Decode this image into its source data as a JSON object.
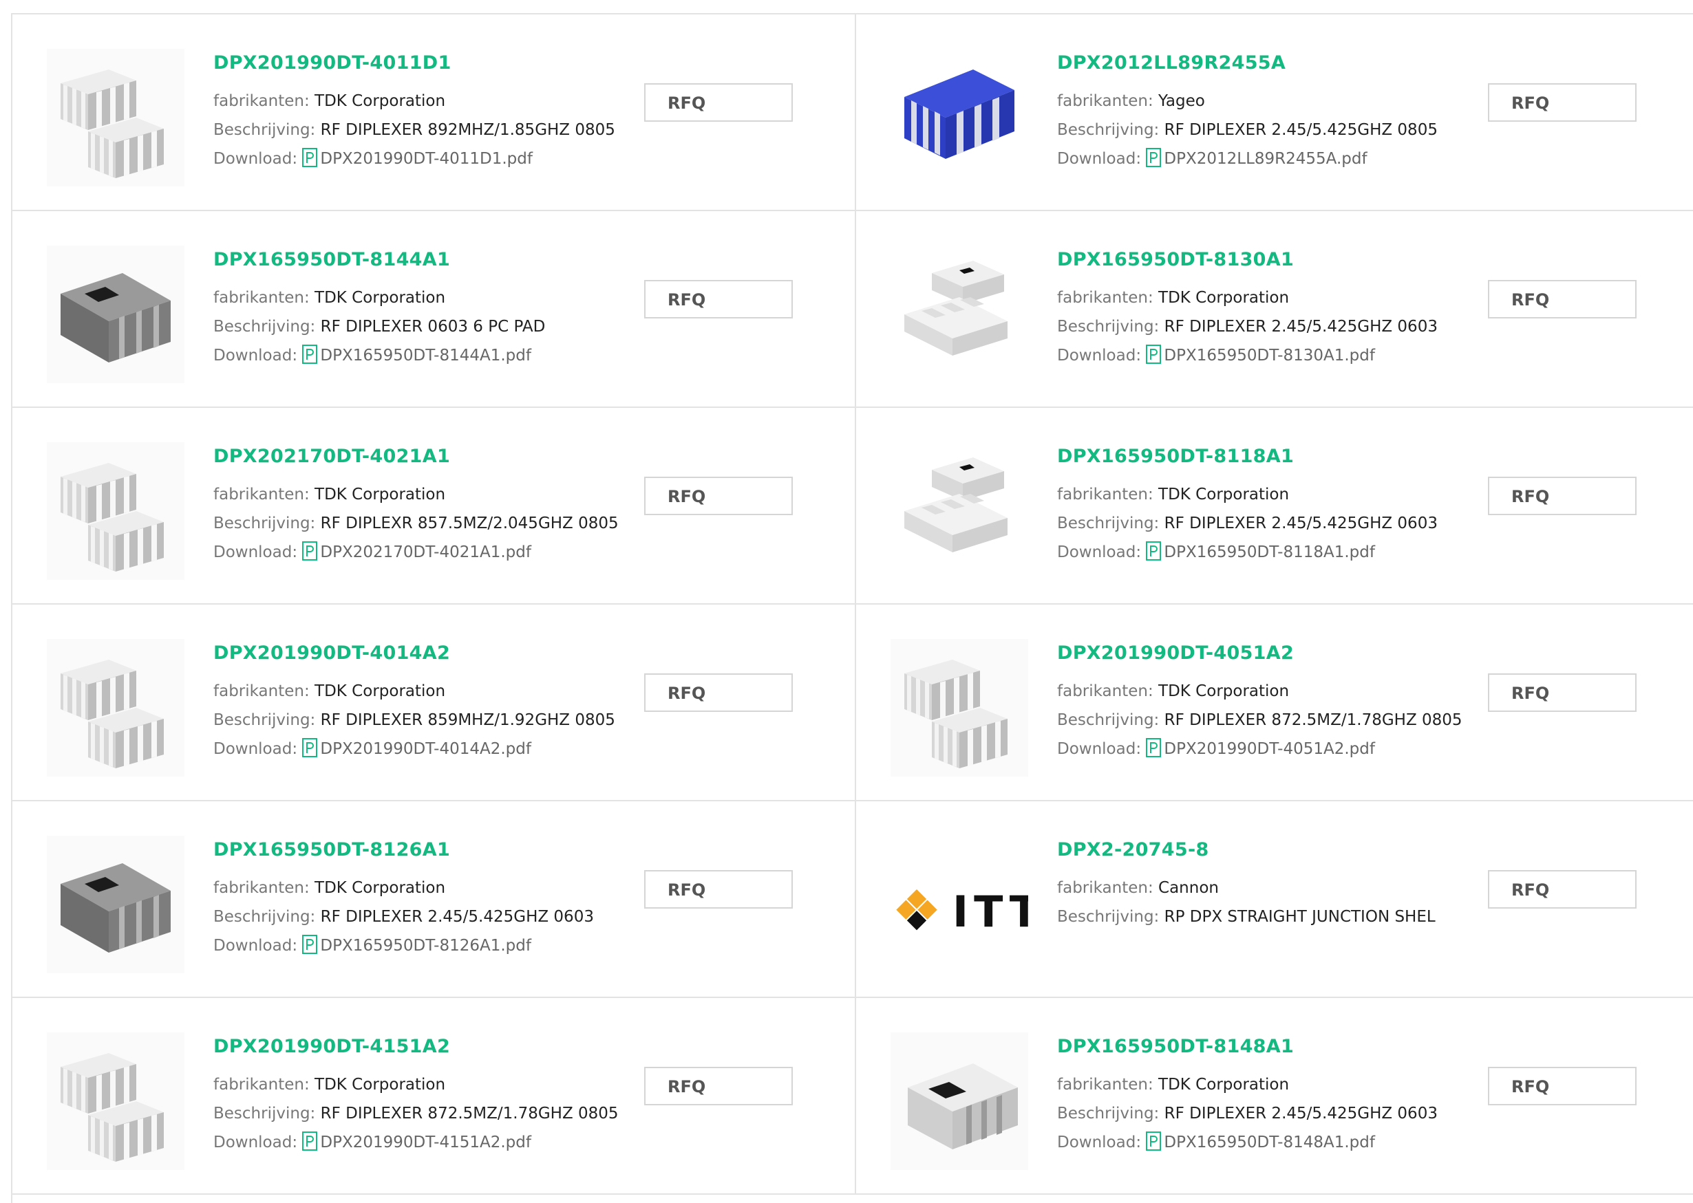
{
  "labels": {
    "manufacturer": "fabrikanten:",
    "description": "Beschrijving:",
    "download": "Download:",
    "rfq": "RFQ"
  },
  "colors": {
    "accent": "#12b980",
    "border": "#e3e3e3"
  },
  "products": [
    {
      "part": "DPX201990DT-4011D1",
      "manufacturer": "TDK Corporation",
      "description": "RF DIPLEXER 892MHZ/1.85GHZ 0805",
      "pdf": "DPX201990DT-4011D1.pdf",
      "image": "tdk-two-chips-icon"
    },
    {
      "part": "DPX2012LL89R2455A",
      "manufacturer": "Yageo",
      "description": "RF DIPLEXER 2.45/5.425GHZ 0805",
      "pdf": "DPX2012LL89R2455A.pdf",
      "image": "blue-chip-icon"
    },
    {
      "part": "DPX165950DT-8144A1",
      "manufacturer": "TDK Corporation",
      "description": "RF DIPLEXER 0603 6 PC PAD",
      "pdf": "DPX165950DT-8144A1.pdf",
      "image": "dark-chip-icon"
    },
    {
      "part": "DPX165950DT-8130A1",
      "manufacturer": "TDK Corporation",
      "description": "RF DIPLEXER 2.45/5.425GHZ 0603",
      "pdf": "DPX165950DT-8130A1.pdf",
      "image": "white-chips-icon"
    },
    {
      "part": "DPX202170DT-4021A1",
      "manufacturer": "TDK Corporation",
      "description": "RF DIPLEXR 857.5MZ/2.045GHZ 0805",
      "pdf": "DPX202170DT-4021A1.pdf",
      "image": "tdk-two-chips-icon"
    },
    {
      "part": "DPX165950DT-8118A1",
      "manufacturer": "TDK Corporation",
      "description": "RF DIPLEXER 2.45/5.425GHZ 0603",
      "pdf": "DPX165950DT-8118A1.pdf",
      "image": "white-chips-icon"
    },
    {
      "part": "DPX201990DT-4014A2",
      "manufacturer": "TDK Corporation",
      "description": "RF DIPLEXER 859MHZ/1.92GHZ 0805",
      "pdf": "DPX201990DT-4014A2.pdf",
      "image": "tdk-two-chips-icon"
    },
    {
      "part": "DPX201990DT-4051A2",
      "manufacturer": "TDK Corporation",
      "description": "RF DIPLEXER 872.5MZ/1.78GHZ 0805",
      "pdf": "DPX201990DT-4051A2.pdf",
      "image": "tdk-two-chips-icon"
    },
    {
      "part": "DPX165950DT-8126A1",
      "manufacturer": "TDK Corporation",
      "description": "RF DIPLEXER 2.45/5.425GHZ 0603",
      "pdf": "DPX165950DT-8126A1.pdf",
      "image": "dark-chip-icon"
    },
    {
      "part": "DPX2-20745-8",
      "manufacturer": "Cannon",
      "description": "RP DPX STRAIGHT JUNCTION SHEL",
      "pdf": "",
      "image": "itt-logo",
      "logo_text": "ITT"
    },
    {
      "part": "DPX201990DT-4151A2",
      "manufacturer": "TDK Corporation",
      "description": "RF DIPLEXER 872.5MZ/1.78GHZ 0805",
      "pdf": "DPX201990DT-4151A2.pdf",
      "image": "tdk-two-chips-icon"
    },
    {
      "part": "DPX165950DT-8148A1",
      "manufacturer": "TDK Corporation",
      "description": "RF DIPLEXER 2.45/5.425GHZ 0603",
      "pdf": "DPX165950DT-8148A1.pdf",
      "image": "single-chip-icon"
    }
  ]
}
